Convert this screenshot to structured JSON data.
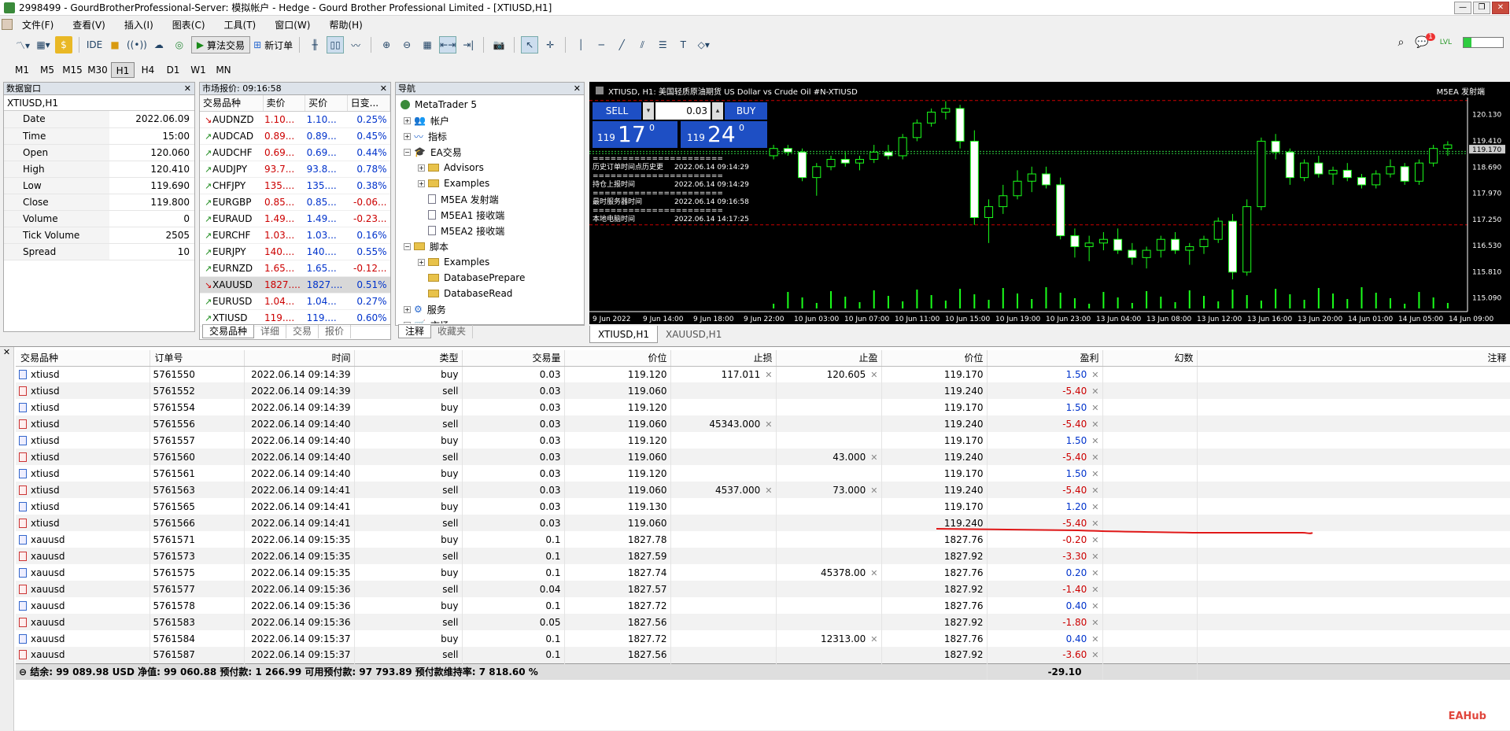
{
  "window": {
    "title": "2998499 - GourdBrotherProfessional-Server: 模拟帐户 - Hedge - Gourd Brother Professional Limited - [XTIUSD,H1]"
  },
  "menu": [
    "文件(F)",
    "查看(V)",
    "插入(I)",
    "图表(C)",
    "工具(T)",
    "窗口(W)",
    "帮助(H)"
  ],
  "toolbar": {
    "ide": "IDE",
    "algo": "算法交易",
    "neworder": "新订单",
    "notif_count": "1",
    "lvl": "LVL"
  },
  "timeframes": [
    "M1",
    "M5",
    "M15",
    "M30",
    "H1",
    "H4",
    "D1",
    "W1",
    "MN"
  ],
  "data_window": {
    "title": "数据窗口",
    "symbol": "XTIUSD,H1",
    "rows": [
      {
        "k": "Date",
        "v": "2022.06.09"
      },
      {
        "k": "Time",
        "v": "15:00"
      },
      {
        "k": "Open",
        "v": "120.060"
      },
      {
        "k": "High",
        "v": "120.410"
      },
      {
        "k": "Low",
        "v": "119.690"
      },
      {
        "k": "Close",
        "v": "119.800"
      },
      {
        "k": "Volume",
        "v": "0"
      },
      {
        "k": "Tick Volume",
        "v": "2505"
      },
      {
        "k": "Spread",
        "v": "10"
      }
    ]
  },
  "market_watch": {
    "title": "市场报价: 09:16:58",
    "headers": [
      "交易品种",
      "卖价",
      "买价",
      "日变..."
    ],
    "rows": [
      {
        "s": "AUDNZD",
        "b": "1.10...",
        "a": "1.10...",
        "c": "0.25%",
        "dir": "dn",
        "neg": false
      },
      {
        "s": "AUDCAD",
        "b": "0.89...",
        "a": "0.89...",
        "c": "0.45%",
        "dir": "up",
        "neg": false
      },
      {
        "s": "AUDCHF",
        "b": "0.69...",
        "a": "0.69...",
        "c": "0.44%",
        "dir": "up",
        "neg": false
      },
      {
        "s": "AUDJPY",
        "b": "93.7...",
        "a": "93.8...",
        "c": "0.78%",
        "dir": "up",
        "neg": false
      },
      {
        "s": "CHFJPY",
        "b": "135....",
        "a": "135....",
        "c": "0.38%",
        "dir": "up",
        "neg": false
      },
      {
        "s": "EURGBP",
        "b": "0.85...",
        "a": "0.85...",
        "c": "-0.06...",
        "dir": "up",
        "neg": true
      },
      {
        "s": "EURAUD",
        "b": "1.49...",
        "a": "1.49...",
        "c": "-0.23...",
        "dir": "up",
        "neg": true
      },
      {
        "s": "EURCHF",
        "b": "1.03...",
        "a": "1.03...",
        "c": "0.16%",
        "dir": "up",
        "neg": false
      },
      {
        "s": "EURJPY",
        "b": "140....",
        "a": "140....",
        "c": "0.55%",
        "dir": "up",
        "neg": false
      },
      {
        "s": "EURNZD",
        "b": "1.65...",
        "a": "1.65...",
        "c": "-0.12...",
        "dir": "up",
        "neg": true
      },
      {
        "s": "XAUUSD",
        "b": "1827....",
        "a": "1827....",
        "c": "0.51%",
        "dir": "dn",
        "neg": false
      },
      {
        "s": "EURUSD",
        "b": "1.04...",
        "a": "1.04...",
        "c": "0.27%",
        "dir": "up",
        "neg": false
      },
      {
        "s": "XTIUSD",
        "b": "119....",
        "a": "119....",
        "c": "0.60%",
        "dir": "up",
        "neg": false
      }
    ],
    "tabs": [
      "交易品种",
      "详细",
      "交易",
      "报价"
    ]
  },
  "navigator": {
    "title": "导航",
    "items": [
      {
        "label": "MetaTrader 5",
        "lvl": 0,
        "kind": "root"
      },
      {
        "label": "帐户",
        "lvl": 1,
        "kind": "acct"
      },
      {
        "label": "指标",
        "lvl": 1,
        "kind": "ind"
      },
      {
        "label": "EA交易",
        "lvl": 1,
        "kind": "ea"
      },
      {
        "label": "Advisors",
        "lvl": 2,
        "kind": "folder"
      },
      {
        "label": "Examples",
        "lvl": 2,
        "kind": "folder"
      },
      {
        "label": "M5EA 发射端",
        "lvl": 2,
        "kind": "doc"
      },
      {
        "label": "M5EA1 接收端",
        "lvl": 2,
        "kind": "doc"
      },
      {
        "label": "M5EA2 接收端",
        "lvl": 2,
        "kind": "doc"
      },
      {
        "label": "脚本",
        "lvl": 1,
        "kind": "script"
      },
      {
        "label": "Examples",
        "lvl": 2,
        "kind": "folder"
      },
      {
        "label": "DatabasePrepare",
        "lvl": 2,
        "kind": "folderdoc"
      },
      {
        "label": "DatabaseRead",
        "lvl": 2,
        "kind": "folderdoc"
      },
      {
        "label": "服务",
        "lvl": 1,
        "kind": "svc"
      },
      {
        "label": "市场",
        "lvl": 1,
        "kind": "mkt"
      }
    ],
    "tabs": [
      "注释",
      "收藏夹"
    ]
  },
  "chart": {
    "header": "XTIUSD, H1: 美国轻质原油期货 US Dollar vs Crude Oil #N-XTIUSD",
    "ea_label": "M5EA 发射端",
    "sell_label": "SELL",
    "buy_label": "BUY",
    "lot": "0.03",
    "sell_price_small": "119",
    "sell_price_big": "17",
    "sell_price_sup": "0",
    "buy_price_small": "119",
    "buy_price_big": "24",
    "buy_price_sup": "0",
    "comments": [
      {
        "line": "======================"
      },
      {
        "line": "历史订单时间点历史更",
        "time": "2022.06.14 09:14:29"
      },
      {
        "line": "======================"
      },
      {
        "line": "持仓上报时间",
        "time": "2022.06.14 09:14:29"
      },
      {
        "line": "======================"
      },
      {
        "line": "最时服务器时间",
        "time": "2022.06.14 09:16:58"
      },
      {
        "line": "======================"
      },
      {
        "line": "本地电脑时间",
        "time": "2022.06.14 14:17:25"
      }
    ],
    "price_labels": [
      "120.130",
      "119.410",
      "119.170",
      "118.690",
      "117.970",
      "117.250",
      "116.530",
      "115.810",
      "115.090"
    ],
    "current_price": "119.170",
    "time_labels": [
      "9 Jun 2022",
      "9 Jun 14:00",
      "9 Jun 18:00",
      "9 Jun 22:00",
      "10 Jun 03:00",
      "10 Jun 07:00",
      "10 Jun 11:00",
      "10 Jun 15:00",
      "10 Jun 19:00",
      "10 Jun 23:00",
      "13 Jun 04:00",
      "13 Jun 08:00",
      "13 Jun 12:00",
      "13 Jun 16:00",
      "13 Jun 20:00",
      "14 Jun 01:00",
      "14 Jun 05:00",
      "14 Jun 09:00"
    ],
    "tabs": [
      "XTIUSD,H1",
      "XAUUSD,H1"
    ]
  },
  "chart_data": {
    "type": "candlestick",
    "title": "XTIUSD, H1",
    "ylim": [
      114.8,
      120.6
    ],
    "candles": [
      [
        119.0,
        119.3,
        118.9,
        119.2
      ],
      [
        119.2,
        119.3,
        119.0,
        119.1
      ],
      [
        119.1,
        119.2,
        118.3,
        118.4
      ],
      [
        118.4,
        118.8,
        117.9,
        118.7
      ],
      [
        118.7,
        119.0,
        118.6,
        118.9
      ],
      [
        118.9,
        119.1,
        118.7,
        118.8
      ],
      [
        118.8,
        119.0,
        118.6,
        118.9
      ],
      [
        118.9,
        119.3,
        118.8,
        119.1
      ],
      [
        119.1,
        119.3,
        118.9,
        119.0
      ],
      [
        119.0,
        119.6,
        118.9,
        119.5
      ],
      [
        119.5,
        120.0,
        119.4,
        119.9
      ],
      [
        119.9,
        120.3,
        119.8,
        120.2
      ],
      [
        120.2,
        120.5,
        120.0,
        120.3
      ],
      [
        120.3,
        120.4,
        119.2,
        119.4
      ],
      [
        119.4,
        119.7,
        117.1,
        117.3
      ],
      [
        117.3,
        117.8,
        116.6,
        117.6
      ],
      [
        117.6,
        118.2,
        117.4,
        117.9
      ],
      [
        117.9,
        118.6,
        117.8,
        118.3
      ],
      [
        118.3,
        118.7,
        118.0,
        118.5
      ],
      [
        118.5,
        118.7,
        118.1,
        118.2
      ],
      [
        118.2,
        118.4,
        116.7,
        116.8
      ],
      [
        116.8,
        117.0,
        116.2,
        116.5
      ],
      [
        116.5,
        116.8,
        116.1,
        116.6
      ],
      [
        116.6,
        116.9,
        116.4,
        116.7
      ],
      [
        116.7,
        117.0,
        116.3,
        116.4
      ],
      [
        116.4,
        116.6,
        116.0,
        116.2
      ],
      [
        116.2,
        116.5,
        115.9,
        116.4
      ],
      [
        116.4,
        116.8,
        116.2,
        116.7
      ],
      [
        116.7,
        116.9,
        116.3,
        116.4
      ],
      [
        116.4,
        116.6,
        116.0,
        116.5
      ],
      [
        116.5,
        116.8,
        116.3,
        116.7
      ],
      [
        116.7,
        117.3,
        116.6,
        117.2
      ],
      [
        117.2,
        117.4,
        115.6,
        115.8
      ],
      [
        115.8,
        117.8,
        115.7,
        117.6
      ],
      [
        117.6,
        119.5,
        117.5,
        119.4
      ],
      [
        119.4,
        119.6,
        118.9,
        119.1
      ],
      [
        119.1,
        119.2,
        118.2,
        118.4
      ],
      [
        118.4,
        118.9,
        118.3,
        118.8
      ],
      [
        118.8,
        119.0,
        118.4,
        118.5
      ],
      [
        118.5,
        118.7,
        118.2,
        118.6
      ],
      [
        118.6,
        118.8,
        118.3,
        118.4
      ],
      [
        118.4,
        118.5,
        118.1,
        118.2
      ],
      [
        118.2,
        118.6,
        118.1,
        118.5
      ],
      [
        118.5,
        118.9,
        118.4,
        118.7
      ],
      [
        118.7,
        118.8,
        118.2,
        118.3
      ],
      [
        118.3,
        118.9,
        118.2,
        118.8
      ],
      [
        118.8,
        119.3,
        118.7,
        119.2
      ],
      [
        119.2,
        119.4,
        119.0,
        119.3
      ]
    ]
  },
  "trade": {
    "headers": [
      "交易品种",
      "订单号",
      "时间",
      "类型",
      "交易量",
      "价位",
      "止损",
      "止盈",
      "价位",
      "盈利",
      "幻数",
      "注释"
    ],
    "rows": [
      {
        "sym": "xtiusd",
        "ord": "5761550",
        "t": "2022.06.14 09:14:39",
        "type": "buy",
        "vol": "0.03",
        "p": "119.120",
        "sl": "117.011",
        "tp": "120.605",
        "cp": "119.170",
        "pl": "1.50"
      },
      {
        "sym": "xtiusd",
        "ord": "5761552",
        "t": "2022.06.14 09:14:39",
        "type": "sell",
        "vol": "0.03",
        "p": "119.060",
        "sl": "",
        "tp": "",
        "cp": "119.240",
        "pl": "-5.40"
      },
      {
        "sym": "xtiusd",
        "ord": "5761554",
        "t": "2022.06.14 09:14:39",
        "type": "buy",
        "vol": "0.03",
        "p": "119.120",
        "sl": "",
        "tp": "",
        "cp": "119.170",
        "pl": "1.50"
      },
      {
        "sym": "xtiusd",
        "ord": "5761556",
        "t": "2022.06.14 09:14:40",
        "type": "sell",
        "vol": "0.03",
        "p": "119.060",
        "sl": "45343.000",
        "tp": "",
        "cp": "119.240",
        "pl": "-5.40"
      },
      {
        "sym": "xtiusd",
        "ord": "5761557",
        "t": "2022.06.14 09:14:40",
        "type": "buy",
        "vol": "0.03",
        "p": "119.120",
        "sl": "",
        "tp": "",
        "cp": "119.170",
        "pl": "1.50"
      },
      {
        "sym": "xtiusd",
        "ord": "5761560",
        "t": "2022.06.14 09:14:40",
        "type": "sell",
        "vol": "0.03",
        "p": "119.060",
        "sl": "",
        "tp": "43.000",
        "cp": "119.240",
        "pl": "-5.40"
      },
      {
        "sym": "xtiusd",
        "ord": "5761561",
        "t": "2022.06.14 09:14:40",
        "type": "buy",
        "vol": "0.03",
        "p": "119.120",
        "sl": "",
        "tp": "",
        "cp": "119.170",
        "pl": "1.50"
      },
      {
        "sym": "xtiusd",
        "ord": "5761563",
        "t": "2022.06.14 09:14:41",
        "type": "sell",
        "vol": "0.03",
        "p": "119.060",
        "sl": "4537.000",
        "tp": "73.000",
        "cp": "119.240",
        "pl": "-5.40"
      },
      {
        "sym": "xtiusd",
        "ord": "5761565",
        "t": "2022.06.14 09:14:41",
        "type": "buy",
        "vol": "0.03",
        "p": "119.130",
        "sl": "",
        "tp": "",
        "cp": "119.170",
        "pl": "1.20"
      },
      {
        "sym": "xtiusd",
        "ord": "5761566",
        "t": "2022.06.14 09:14:41",
        "type": "sell",
        "vol": "0.03",
        "p": "119.060",
        "sl": "",
        "tp": "",
        "cp": "119.240",
        "pl": "-5.40"
      },
      {
        "sym": "xauusd",
        "ord": "5761571",
        "t": "2022.06.14 09:15:35",
        "type": "buy",
        "vol": "0.1",
        "p": "1827.78",
        "sl": "",
        "tp": "",
        "cp": "1827.76",
        "pl": "-0.20"
      },
      {
        "sym": "xauusd",
        "ord": "5761573",
        "t": "2022.06.14 09:15:35",
        "type": "sell",
        "vol": "0.1",
        "p": "1827.59",
        "sl": "",
        "tp": "",
        "cp": "1827.92",
        "pl": "-3.30"
      },
      {
        "sym": "xauusd",
        "ord": "5761575",
        "t": "2022.06.14 09:15:35",
        "type": "buy",
        "vol": "0.1",
        "p": "1827.74",
        "sl": "",
        "tp": "45378.00",
        "cp": "1827.76",
        "pl": "0.20"
      },
      {
        "sym": "xauusd",
        "ord": "5761577",
        "t": "2022.06.14 09:15:36",
        "type": "sell",
        "vol": "0.04",
        "p": "1827.57",
        "sl": "",
        "tp": "",
        "cp": "1827.92",
        "pl": "-1.40"
      },
      {
        "sym": "xauusd",
        "ord": "5761578",
        "t": "2022.06.14 09:15:36",
        "type": "buy",
        "vol": "0.1",
        "p": "1827.72",
        "sl": "",
        "tp": "",
        "cp": "1827.76",
        "pl": "0.40"
      },
      {
        "sym": "xauusd",
        "ord": "5761583",
        "t": "2022.06.14 09:15:36",
        "type": "sell",
        "vol": "0.05",
        "p": "1827.56",
        "sl": "",
        "tp": "",
        "cp": "1827.92",
        "pl": "-1.80"
      },
      {
        "sym": "xauusd",
        "ord": "5761584",
        "t": "2022.06.14 09:15:37",
        "type": "buy",
        "vol": "0.1",
        "p": "1827.72",
        "sl": "",
        "tp": "12313.00",
        "cp": "1827.76",
        "pl": "0.40"
      },
      {
        "sym": "xauusd",
        "ord": "5761587",
        "t": "2022.06.14 09:15:37",
        "type": "sell",
        "vol": "0.1",
        "p": "1827.56",
        "sl": "",
        "tp": "",
        "cp": "1827.92",
        "pl": "-3.60"
      }
    ],
    "summary": "结余: 99 089.98 USD  净值: 99 060.88  预付款: 1 266.99  可用预付款: 97 793.89  预付款维持率: 7 818.60 %",
    "total_pl": "-29.10"
  },
  "watermark": "EAHub"
}
